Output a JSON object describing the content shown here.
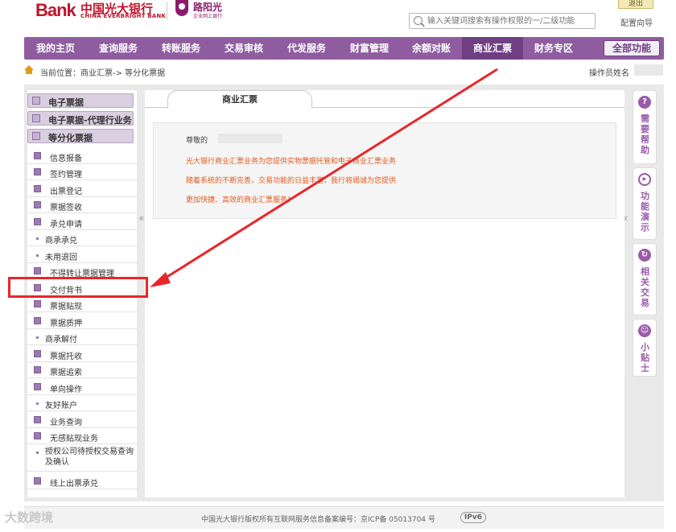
{
  "header": {
    "logo_bank": "Bank",
    "logo_cn": "中国光大银行",
    "logo_en": "CHINA EVERBRIGHT BANK",
    "logo_sub1": "路阳光",
    "logo_sub2": "企业网上银行",
    "search_placeholder": "输入关键词搜索有操作权限的一/二级功能",
    "logout": "退出",
    "config": "配置向导"
  },
  "nav": {
    "items": [
      "我的主页",
      "查询服务",
      "转账服务",
      "交易审核",
      "代发服务",
      "财富管理",
      "余额对账",
      "商业汇票",
      "财务专区"
    ],
    "active_index": 7,
    "all_label": "全部功能"
  },
  "breadcrumb": {
    "text": "当前位置：商业汇票->  等分化票据",
    "operator_label": "操作员姓名"
  },
  "sidebar": {
    "headers": [
      "电子票据",
      "电子票据-代理行业务",
      "等分化票据"
    ],
    "items": [
      {
        "label": "信息报备",
        "type": "square"
      },
      {
        "label": "签约管理",
        "type": "square"
      },
      {
        "label": "出票登记",
        "type": "square"
      },
      {
        "label": "票据签收",
        "type": "square"
      },
      {
        "label": "承兑申请",
        "type": "square"
      },
      {
        "label": "商承承兑",
        "type": "dot"
      },
      {
        "label": "未用退回",
        "type": "dot"
      },
      {
        "label": "不得转让票据管理",
        "type": "square"
      },
      {
        "label": "交付背书",
        "type": "square"
      },
      {
        "label": "票据贴现",
        "type": "square"
      },
      {
        "label": "票据质押",
        "type": "square"
      },
      {
        "label": "商承解付",
        "type": "dot"
      },
      {
        "label": "票据托收",
        "type": "square"
      },
      {
        "label": "票据追索",
        "type": "square"
      },
      {
        "label": "单向操作",
        "type": "square"
      },
      {
        "label": "友好账户",
        "type": "dot"
      },
      {
        "label": "业务查询",
        "type": "square"
      },
      {
        "label": "无感贴现业务",
        "type": "square"
      },
      {
        "label": "授权公司待授权交易查询及确认",
        "type": "dot"
      },
      {
        "label": "线上出票承兑",
        "type": "square"
      }
    ],
    "collapse": "«"
  },
  "content": {
    "tab": "商业汇票",
    "greeting": "尊敬的",
    "lines": [
      "光大银行商业汇票业务为您提供实物票据托管和电子商业汇票业务",
      "随着系统的不断完善，交易功能的日益丰富，我行将竭诚为您提供",
      "更加快捷、高效的商业汇票服务！"
    ]
  },
  "helper": {
    "cards": [
      {
        "icon": "?",
        "text": "需要帮助"
      },
      {
        "icon": "▸",
        "text": "功能演示"
      },
      {
        "icon": "↻",
        "text": "相关交易"
      },
      {
        "icon": "☺",
        "text": "小贴士"
      }
    ]
  },
  "footer": {
    "text": "中国光大银行版权所有互联网服务信息备案编号：京ICP备 05013704 号",
    "ipv6": "IPv6",
    "watermark": "大数跨境"
  },
  "colors": {
    "nav_bg": "#8f5d9f",
    "nav_active": "#6f3f82",
    "brand_red": "#c0142b",
    "notice_text": "#e05a1e",
    "annotation_red": "#e8262a"
  }
}
